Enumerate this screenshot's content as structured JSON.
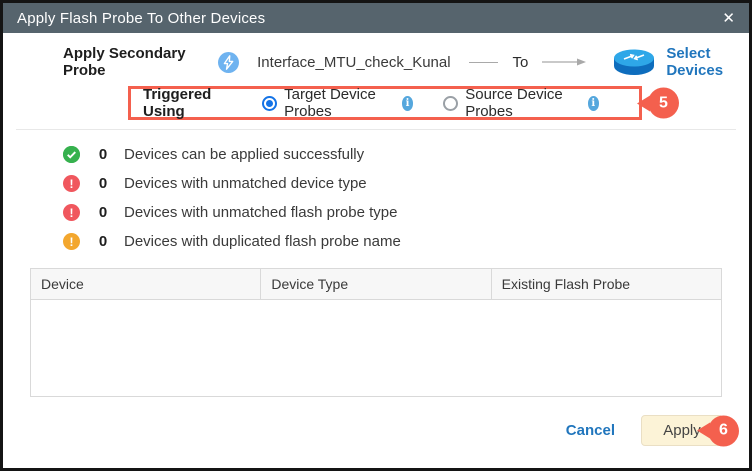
{
  "dialog": {
    "title": "Apply Flash Probe To Other Devices"
  },
  "icons": {
    "close_glyph": "✕",
    "info_glyph": "i",
    "exclamation_glyph": "!"
  },
  "probe_row": {
    "label": "Apply Secondary Probe",
    "probe_name": "Interface_MTU_check_Kunal",
    "to_label": "To",
    "select_devices_label": "Select Devices"
  },
  "triggered": {
    "label": "Triggered Using",
    "options": [
      {
        "label": "Target Device Probes",
        "selected": true
      },
      {
        "label": "Source Device Probes",
        "selected": false
      }
    ],
    "callout_number": "5"
  },
  "status_items": [
    {
      "icon": "success",
      "count": "0",
      "text": "Devices can be applied successfully"
    },
    {
      "icon": "error",
      "count": "0",
      "text": "Devices with unmatched device type"
    },
    {
      "icon": "error",
      "count": "0",
      "text": "Devices with unmatched flash probe type"
    },
    {
      "icon": "warning",
      "count": "0",
      "text": "Devices with duplicated flash probe name"
    }
  ],
  "table": {
    "columns": [
      "Device",
      "Device Type",
      "Existing Flash Probe"
    ],
    "rows": []
  },
  "footer": {
    "cancel_label": "Cancel",
    "apply_label": "Apply",
    "callout_number": "6"
  },
  "colors": {
    "titlebar_bg": "#56646d",
    "callout_red": "#f4604e",
    "link_blue": "#2176bd",
    "radio_blue": "#1473e6",
    "info_blue": "#55a7dd",
    "success_green": "#36b14e",
    "error_red": "#f0575e",
    "warning_orange": "#f3a72e",
    "apply_bg": "#fcf3d7"
  }
}
